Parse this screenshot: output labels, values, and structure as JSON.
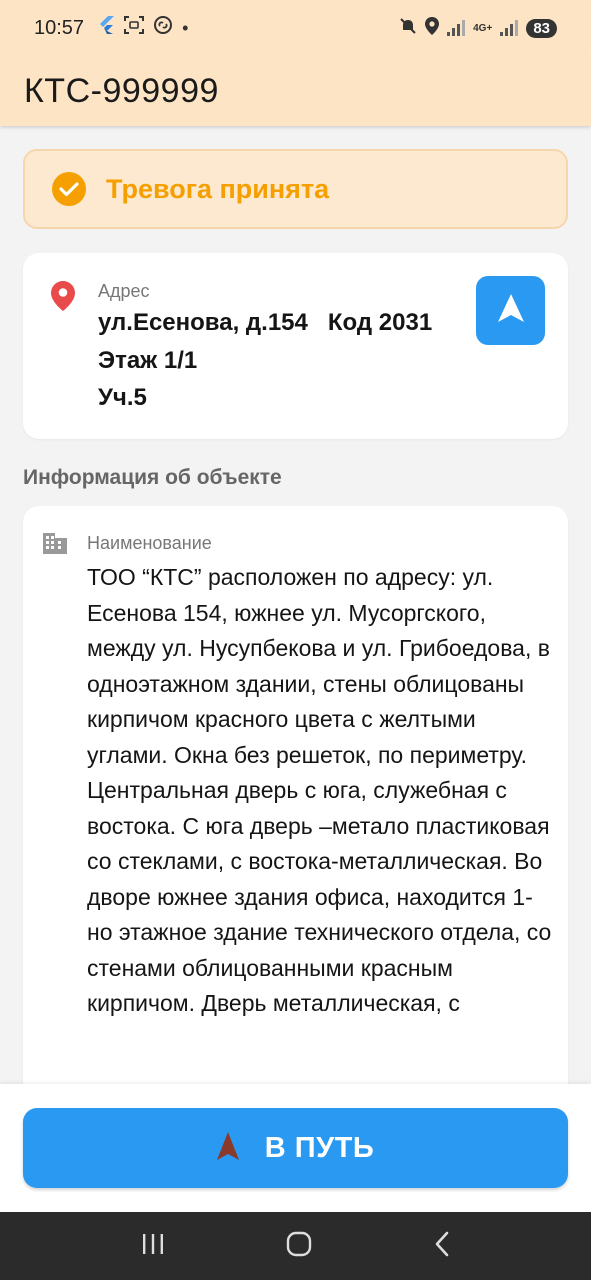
{
  "status_bar": {
    "time": "10:57",
    "battery": "83",
    "network": "4G+"
  },
  "app_bar": {
    "title": "КТС-999999"
  },
  "alarm_banner": {
    "text": "Тревога принята",
    "color": "#f5a000"
  },
  "address_card": {
    "label": "Адрес",
    "line1": "ул.Есенова, д.154   Код 2031",
    "line2": "Этаж 1/1",
    "line3": "Уч.5"
  },
  "object_info": {
    "section_title": "Информация об объекте",
    "name_label": "Наименование",
    "description": "ТОО “КТС” расположен по адресу: ул. Есенова 154, южнее ул. Мусоргского, между ул. Нусупбекова и ул. Грибоедова, в одноэтажном здании, стены облицованы кирпичом красного цвета с  желтыми углами. Окна без решеток, по периметру. Центральная дверь с юга, служебная с востока. С юга дверь –метало пластиковая со стеклами, с востока-металлическая. Во дворе южнее здания офиса, находится 1-но этажное здание технического отдела, со стенами облицованными  красным кирпичом. Дверь металлическая, с"
  },
  "action_button": {
    "label": "В ПУТЬ",
    "color": "#2a99f2"
  },
  "icons": {
    "check": "check-circle-icon",
    "pin": "location-pin-icon",
    "navigate": "navigation-arrow-icon",
    "building": "building-icon",
    "go": "navigation-arrow-icon"
  }
}
